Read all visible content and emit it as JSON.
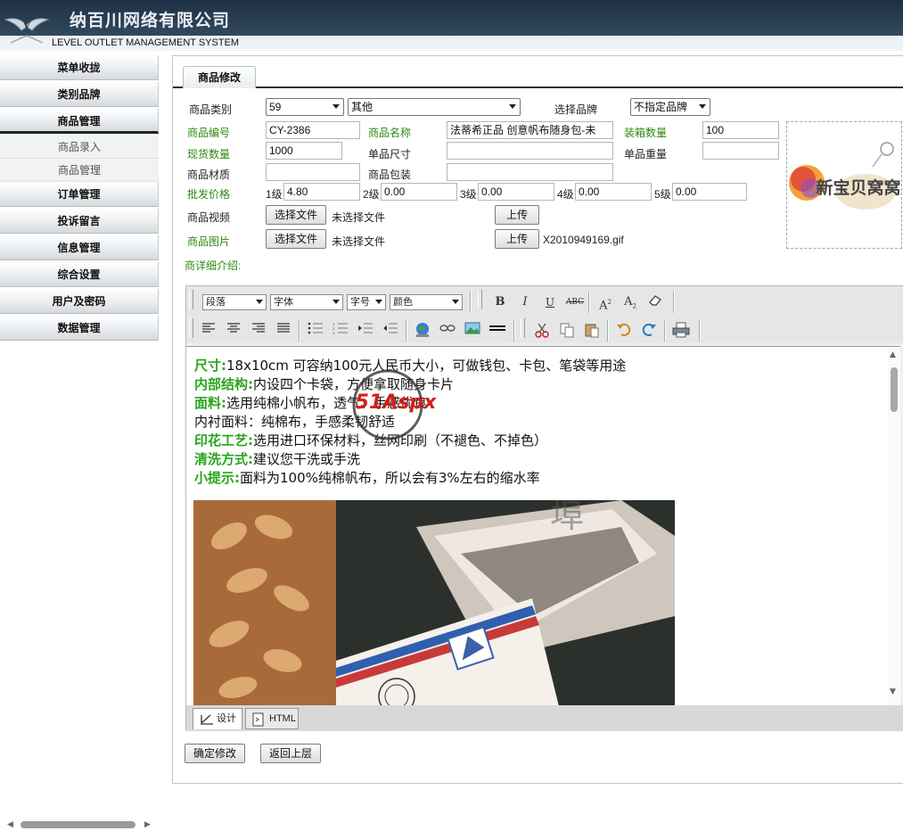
{
  "header": {
    "company_name": "纳百川网络有限公司",
    "system_name": "LEVEL OUTLET MANAGEMENT SYSTEM"
  },
  "sidebar": {
    "items": [
      {
        "label": "菜单收拢"
      },
      {
        "label": "类别品牌"
      },
      {
        "label": "商品管理",
        "active": true
      },
      {
        "label": "订单管理"
      },
      {
        "label": "投诉留言"
      },
      {
        "label": "信息管理"
      },
      {
        "label": "综合设置"
      },
      {
        "label": "用户及密码"
      },
      {
        "label": "数据管理"
      }
    ],
    "sub_items": [
      {
        "label": "商品录入"
      },
      {
        "label": "商品管理"
      }
    ]
  },
  "tab": {
    "label": "商品修改"
  },
  "form": {
    "category_label": "商品类别",
    "category_id": "59",
    "category_name": "其他",
    "brand_label": "选择品牌",
    "brand_value": "不指定品牌",
    "code_label": "商品编号",
    "code_value": "CY-2386",
    "name_label": "商品名称",
    "name_value": "法蒂希正品 创意帆布随身包-未",
    "pack_qty_label": "装箱数量",
    "pack_qty_value": "100",
    "stock_label": "现货数量",
    "stock_value": "1000",
    "size_label": "单品尺寸",
    "size_value": "",
    "weight_label": "单品重量",
    "weight_value": "",
    "material_label": "商品材质",
    "material_value": "",
    "packaging_label": "商品包装",
    "packaging_value": "",
    "wholesale_label": "批发价格",
    "tiers": [
      {
        "label": "1级",
        "value": "4.80"
      },
      {
        "label": "2级",
        "value": "0.00"
      },
      {
        "label": "3级",
        "value": "0.00"
      },
      {
        "label": "4级",
        "value": "0.00"
      },
      {
        "label": "5级",
        "value": "0.00"
      }
    ],
    "video_label": "商品视频",
    "image_label": "商品图片",
    "choose_file": "选择文件",
    "no_file": "未选择文件",
    "upload": "上传",
    "image_filename": "X2010949169.gif",
    "detail_label": "商详细介绍:",
    "brand_logo_text": "新宝贝窝窝"
  },
  "editor": {
    "toolbar": {
      "paragraph": "段落",
      "font": "字体",
      "size": "字号",
      "color": "颜色"
    },
    "content": [
      {
        "key": "尺寸:",
        "text": "18x10cm 可容纳100元人民币大小，可做钱包、卡包、笔袋等用途"
      },
      {
        "key": "内部结构:",
        "text": "内设四个卡袋，方便拿取随身卡片"
      },
      {
        "key": "面料:",
        "text": "选用纯棉小帆布，透气、手感优良"
      },
      {
        "key": "",
        "text": "内衬面料：纯棉布，手感柔韧舒适"
      },
      {
        "key": "印花工艺:",
        "text": "选用进口环保材料，丝网印刷（不褪色、不掉色）"
      },
      {
        "key": "清洗方式:",
        "text": "建议您干洗或手洗"
      },
      {
        "key": "小提示:",
        "text": "面料为100%纯棉帆布，所以会有3%左右的缩水率"
      }
    ],
    "modes": {
      "design": "设计",
      "html": "HTML"
    }
  },
  "actions": {
    "confirm": "确定修改",
    "back": "返回上层"
  },
  "watermark": {
    "text": "51Aspx"
  },
  "colors": {
    "header_dark": "#26384a",
    "green_label": "#2d8a12",
    "green_content": "#2aa51c"
  }
}
